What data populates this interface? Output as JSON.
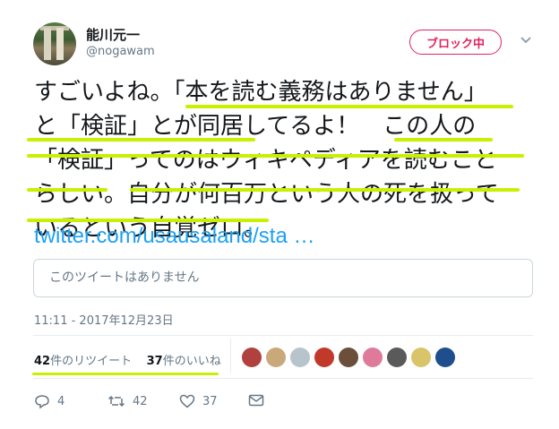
{
  "user": {
    "name": "能川元一",
    "handle": "@nogawam",
    "block_label": "ブロック中"
  },
  "tweet": {
    "lines": [
      "すごいよね。「本を読む義務はありません」",
      "と「検証」とが同居してるよ！　この人の",
      "「検証」ってのはウィキペディアを読むこと",
      "らしい。自分が何百万という人の死を扱って",
      "いるという自覚ゼロ。"
    ],
    "link": "twitter.com/usausaland/sta …",
    "quoted_unavailable": "このツイートはありません",
    "timestamp": "11:11 - 2017年12月23日"
  },
  "stats": {
    "retweet_count": "42",
    "retweet_label": "件のリツイート",
    "like_count": "37",
    "like_label": "件のいいね"
  },
  "actions": {
    "reply_count": "4",
    "retweet_count": "42",
    "like_count": "37"
  },
  "highlight_color": "#c8f000",
  "accent_colors": {
    "link": "#1da1f2",
    "block": "#e0245e"
  },
  "favoriters": [
    {
      "icon": "user-avatar-icon",
      "color": "#b0413e"
    },
    {
      "icon": "user-avatar-icon",
      "color": "#c9a97a"
    },
    {
      "icon": "user-avatar-icon",
      "color": "#b8c4cc"
    },
    {
      "icon": "user-avatar-icon",
      "color": "#c0392b"
    },
    {
      "icon": "user-avatar-icon",
      "color": "#6b4f3a"
    },
    {
      "icon": "user-avatar-icon",
      "color": "#e07a9a"
    },
    {
      "icon": "user-avatar-icon",
      "color": "#5a5a5a"
    },
    {
      "icon": "user-avatar-icon",
      "color": "#d9c46a"
    },
    {
      "icon": "user-avatar-icon",
      "color": "#1f4e8c"
    }
  ]
}
